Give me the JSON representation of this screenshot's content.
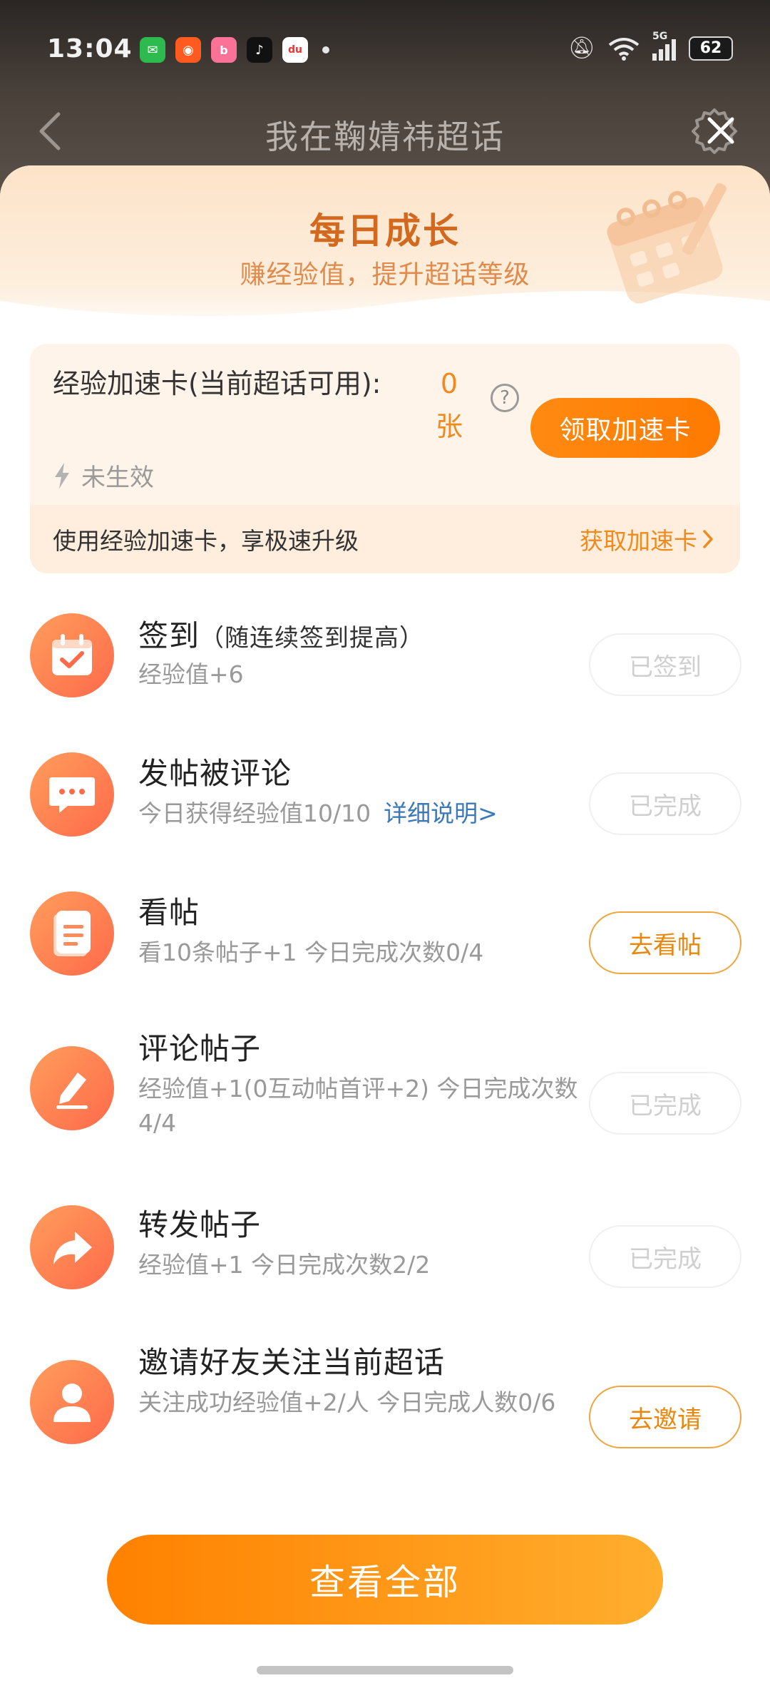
{
  "status_bar": {
    "time": "13:04",
    "battery": "62",
    "network": "5G",
    "apps": [
      {
        "icon": "wechat-icon",
        "glyph": "✉",
        "color": "#2dbb4f"
      },
      {
        "icon": "kuaishou-icon",
        "glyph": "◉",
        "color": "#ff5a1f"
      },
      {
        "icon": "bilibili-icon",
        "glyph": "b",
        "color": "#fb7299"
      },
      {
        "icon": "tiktok-icon",
        "glyph": "♪",
        "color": "#111111"
      },
      {
        "icon": "dewu-icon",
        "glyph": "du",
        "color": "#ffffff"
      }
    ]
  },
  "nav": {
    "title": "我在鞠婧祎超话"
  },
  "header": {
    "title": "每日成长",
    "subtitle": "赚经验值，提升超话等级"
  },
  "boost": {
    "label": "经验加速卡(当前超话可用):",
    "count": "0",
    "unit": "张",
    "help": "?",
    "button": "领取加速卡",
    "status": "未生效",
    "promo": "使用经验加速卡，享极速升级",
    "get_link": "获取加速卡"
  },
  "tasks": [
    {
      "title": "签到",
      "note": "（随连续签到提高）",
      "desc": "经验值+6",
      "link": "",
      "button": "已签到",
      "state": "done",
      "icon": "calendar-check-icon"
    },
    {
      "title": "发帖被评论",
      "note": "",
      "desc": "今日获得经验值10/10",
      "link": "详细说明>",
      "button": "已完成",
      "state": "done",
      "icon": "chat-bubble-icon"
    },
    {
      "title": "看帖",
      "note": "",
      "desc": "看10条帖子+1  今日完成次数0/4",
      "link": "",
      "button": "去看帖",
      "state": "go",
      "icon": "document-icon"
    },
    {
      "title": "评论帖子",
      "note": "",
      "desc": "经验值+1(0互动帖首评+2)  今日完成次数4/4",
      "link": "",
      "button": "已完成",
      "state": "done",
      "icon": "pencil-icon"
    },
    {
      "title": "转发帖子",
      "note": "",
      "desc": "经验值+1  今日完成次数2/2",
      "link": "",
      "button": "已完成",
      "state": "done",
      "icon": "share-arrow-icon"
    },
    {
      "title": "邀请好友关注当前超话",
      "note": "",
      "desc": "关注成功经验值+2/人  今日完成人数0/6",
      "link": "",
      "button": "去邀请",
      "state": "go",
      "icon": "person-icon"
    }
  ],
  "view_all": "查看全部",
  "colors": {
    "accent": "#ff8100",
    "header_title": "#d2691e",
    "link": "#3d78b8"
  }
}
